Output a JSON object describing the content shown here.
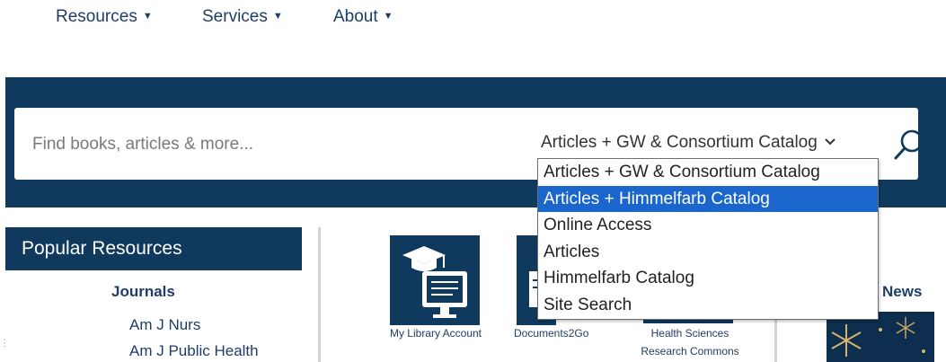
{
  "nav": {
    "items": [
      {
        "label": "Resources"
      },
      {
        "label": "Services"
      },
      {
        "label": "About"
      }
    ]
  },
  "search": {
    "placeholder": "Find books, articles & more...",
    "scope_selected": "Articles + GW & Consortium Catalog",
    "button_icon": "search-icon"
  },
  "scope_dropdown": {
    "options": [
      "Articles + GW & Consortium Catalog",
      "Articles + Himmelfarb Catalog",
      "Online Access",
      "Articles",
      "Himmelfarb Catalog",
      "Site Search"
    ],
    "highlighted": "Articles + Himmelfarb Catalog"
  },
  "popular_resources": {
    "title": "Popular Resources",
    "journals_heading": "Journals",
    "journals": [
      "Am J Nurs",
      "Am J Public Health"
    ]
  },
  "tiles": [
    {
      "label": "My Library Account",
      "icon": "graduation-cap-computer-icon"
    },
    {
      "label": "Documents2Go",
      "icon": "document-icon"
    },
    {
      "label_line1": "Health Sciences",
      "label_line2": "Research Commons",
      "icon": "building-icon"
    }
  ],
  "news": {
    "label": "News"
  },
  "colors": {
    "brand_navy": "#0f3a5e",
    "link_blue": "#1f3d66",
    "selection_blue": "#1b66cc",
    "page_bg": "#ffffff"
  }
}
